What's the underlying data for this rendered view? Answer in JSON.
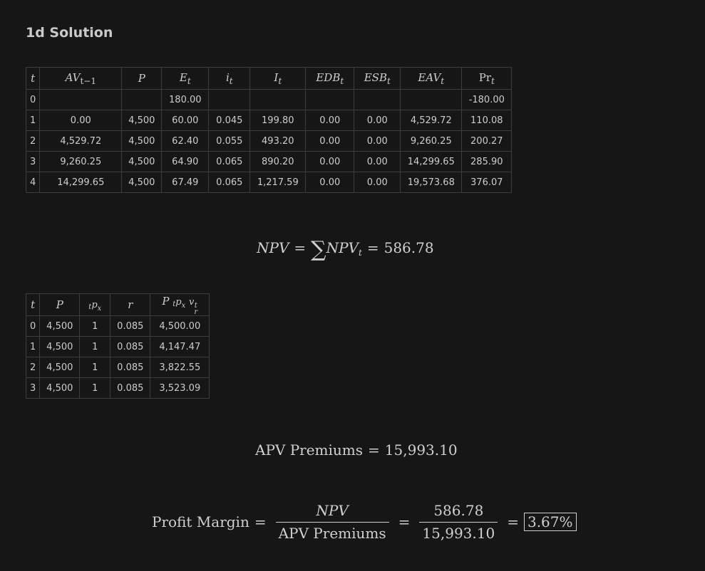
{
  "title": "1d Solution",
  "table1": {
    "headers": [
      {
        "base": "t",
        "sub": ""
      },
      {
        "base": "AV",
        "sub": "t−1"
      },
      {
        "base": "P",
        "sub": ""
      },
      {
        "base": "E",
        "sub": "t"
      },
      {
        "base": "i",
        "sub": "t"
      },
      {
        "base": "I",
        "sub": "t"
      },
      {
        "base": "EDB",
        "sub": "t"
      },
      {
        "base": "ESB",
        "sub": "t"
      },
      {
        "base": "EAV",
        "sub": "t"
      },
      {
        "base": "Pr",
        "sub": "t"
      }
    ],
    "rows": [
      [
        "0",
        "",
        "",
        "180.00",
        "",
        "",
        "",
        "",
        "",
        "-180.00"
      ],
      [
        "1",
        "0.00",
        "4,500",
        "60.00",
        "0.045",
        "199.80",
        "0.00",
        "0.00",
        "4,529.72",
        "110.08"
      ],
      [
        "2",
        "4,529.72",
        "4,500",
        "62.40",
        "0.055",
        "493.20",
        "0.00",
        "0.00",
        "9,260.25",
        "200.27"
      ],
      [
        "3",
        "9,260.25",
        "4,500",
        "64.90",
        "0.065",
        "890.20",
        "0.00",
        "0.00",
        "14,299.65",
        "285.90"
      ],
      [
        "4",
        "14,299.65",
        "4,500",
        "67.49",
        "0.065",
        "1,217.59",
        "0.00",
        "0.00",
        "19,573.68",
        "376.07"
      ]
    ]
  },
  "npv_equation": {
    "lhs": "NPV",
    "sum_term": "NPV",
    "sum_sub": "t",
    "value": "586.78"
  },
  "table2": {
    "headers": [
      "t",
      "P",
      "p",
      "r",
      "P p v"
    ],
    "rows": [
      [
        "0",
        "4,500",
        "1",
        "0.085",
        "4,500.00"
      ],
      [
        "1",
        "4,500",
        "1",
        "0.085",
        "4,147.47"
      ],
      [
        "2",
        "4,500",
        "1",
        "0.085",
        "3,822.55"
      ],
      [
        "3",
        "4,500",
        "1",
        "0.085",
        "3,523.09"
      ]
    ]
  },
  "apv_equation": {
    "label": "APV Premiums",
    "value": "15,993.10"
  },
  "profit_margin": {
    "label": "Profit Margin",
    "numerator": "NPV",
    "denominator": "APV Premiums",
    "num_value": "586.78",
    "den_value": "15,993.10",
    "result": "3.67%"
  }
}
